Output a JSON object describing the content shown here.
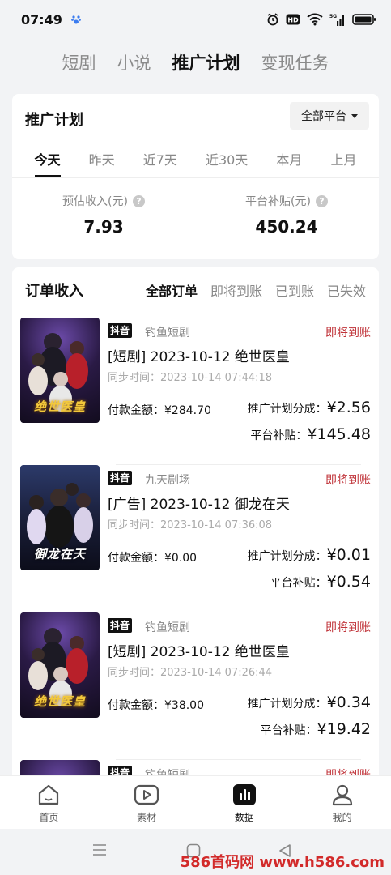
{
  "status_bar": {
    "time": "07:49",
    "hd_label": "HD",
    "signal_label": "5G"
  },
  "top_tabs": [
    {
      "label": "短剧",
      "active": false
    },
    {
      "label": "小说",
      "active": false
    },
    {
      "label": "推广计划",
      "active": true
    },
    {
      "label": "变现任务",
      "active": false
    }
  ],
  "plan": {
    "title": "推广计划",
    "platform_select": "全部平台",
    "periods": [
      {
        "label": "今天",
        "active": true
      },
      {
        "label": "昨天",
        "active": false
      },
      {
        "label": "近7天",
        "active": false
      },
      {
        "label": "近30天",
        "active": false
      },
      {
        "label": "本月",
        "active": false
      },
      {
        "label": "上月",
        "active": false
      }
    ],
    "estimated_income_label": "预估收入(元)",
    "estimated_income_value": "7.93",
    "platform_subsidy_label": "平台补贴(元)",
    "platform_subsidy_value": "450.24"
  },
  "orders": {
    "title": "订单收入",
    "filters": [
      {
        "label": "全部订单",
        "active": true
      },
      {
        "label": "即将到账",
        "active": false
      },
      {
        "label": "已到账",
        "active": false
      },
      {
        "label": "已失效",
        "active": false
      }
    ],
    "items": [
      {
        "platform_tag": "抖音",
        "source": "钓鱼短剧",
        "status": "即将到账",
        "title": "[短剧] 2023-10-12 绝世医皇",
        "sync_time": "同步时间：2023-10-14 07:44:18",
        "pay_label": "付款金额：",
        "pay_amount": "¥284.70",
        "share_label": "推广计划分成：",
        "share_value": "¥2.56",
        "subsidy_label": "平台补贴：",
        "subsidy_value": "¥145.48",
        "poster_text": "绝世医皇"
      },
      {
        "platform_tag": "抖音",
        "source": "九天剧场",
        "status": "即将到账",
        "title": "[广告] 2023-10-12 御龙在天",
        "sync_time": "同步时间：2023-10-14 07:36:08",
        "pay_label": "付款金额：",
        "pay_amount": "¥0.00",
        "share_label": "推广计划分成：",
        "share_value": "¥0.01",
        "subsidy_label": "平台补贴：",
        "subsidy_value": "¥0.54",
        "poster_text": "御龙在天"
      },
      {
        "platform_tag": "抖音",
        "source": "钓鱼短剧",
        "status": "即将到账",
        "title": "[短剧] 2023-10-12 绝世医皇",
        "sync_time": "同步时间：2023-10-14 07:26:44",
        "pay_label": "付款金额：",
        "pay_amount": "¥38.00",
        "share_label": "推广计划分成：",
        "share_value": "¥0.34",
        "subsidy_label": "平台补贴：",
        "subsidy_value": "¥19.42",
        "poster_text": "绝世医皇"
      },
      {
        "platform_tag": "抖音",
        "source": "钓鱼短剧",
        "status": "即将到账"
      }
    ]
  },
  "bottom_nav": [
    {
      "label": "首页",
      "icon": "home-icon",
      "active": false
    },
    {
      "label": "素材",
      "icon": "play-icon",
      "active": false
    },
    {
      "label": "数据",
      "icon": "chart-icon",
      "active": true
    },
    {
      "label": "我的",
      "icon": "user-icon",
      "active": false
    }
  ],
  "watermark": "586首码网 www.h586.com",
  "colors": {
    "accent_red": "#c0343a",
    "background": "#f2f3f5",
    "active_text": "#111111"
  }
}
